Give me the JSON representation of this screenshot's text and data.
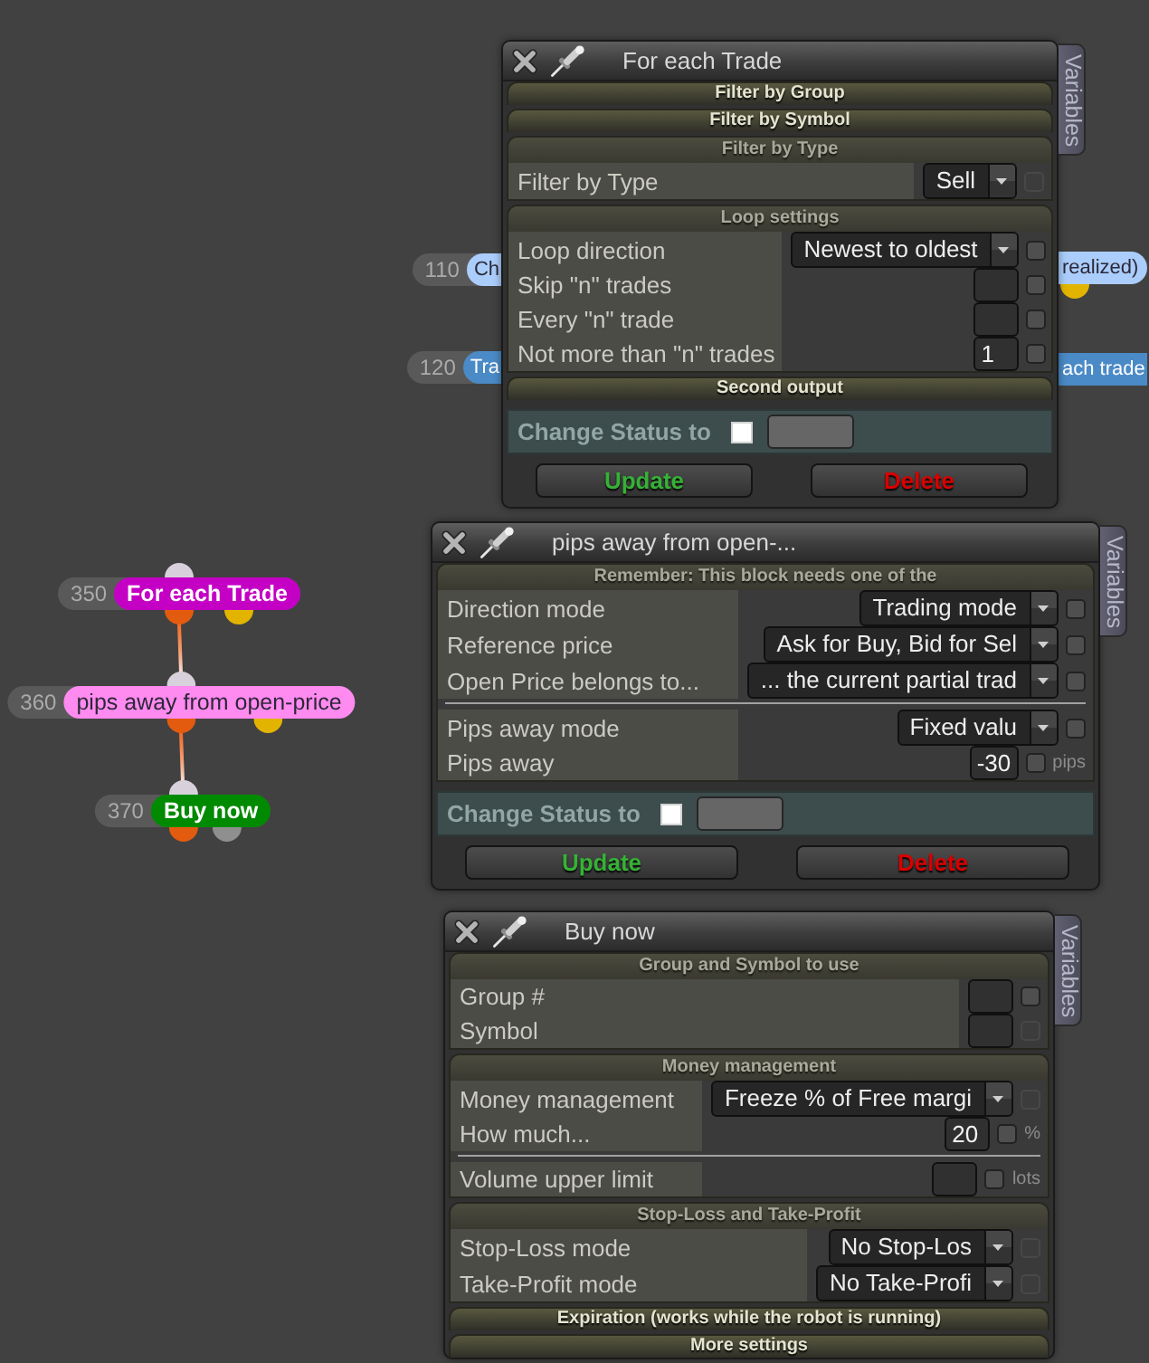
{
  "nodes": [
    {
      "kind": "cut-right",
      "number": "110",
      "label": "Ch",
      "color": "#aacdfb"
    },
    {
      "kind": "cut-left",
      "label": "realized)",
      "color": "#aacdfb",
      "outputs": [
        {
          "color": "#e2b400"
        }
      ]
    },
    {
      "kind": "cut-right",
      "number": "120",
      "label": "Tra",
      "color": "#4a8ac6"
    },
    {
      "kind": "cut-both",
      "label": "ach trade",
      "color": "#4a8ac6"
    },
    {
      "kind": "whole",
      "number": "350",
      "label": "For each Trade",
      "color": "#c400c4",
      "outputs": [
        {
          "color": "#e35b0e"
        },
        {
          "color": "#e2b400"
        }
      ]
    },
    {
      "kind": "whole",
      "number": "360",
      "label": "pips away from open-price",
      "color": "#ff8af0",
      "outputs": [
        {
          "color": "#e35b0e"
        },
        {
          "color": "#e2b400"
        }
      ]
    },
    {
      "kind": "whole",
      "number": "370",
      "label": "Buy now",
      "color": "#008a00",
      "outputs": [
        {
          "color": "#e35b0e"
        },
        {
          "color": "#8f8f8f"
        }
      ]
    }
  ],
  "panels": [
    {
      "title": "For each Trade",
      "tab": "Variables",
      "sections": [
        {
          "title": "Filter by Group",
          "expanded": false
        },
        {
          "title": "Filter by Symbol",
          "expanded": false
        },
        {
          "title": "Filter by Type",
          "expanded": true,
          "groups": [
            {
              "rows": [
                {
                  "label": "Filter by Type",
                  "control": {
                    "kind": "dropdown",
                    "value": "Sell"
                  },
                  "checkbox": {
                    "checked": false,
                    "disabled": true
                  }
                }
              ]
            }
          ]
        },
        {
          "title": "Loop settings",
          "expanded": true,
          "groups": [
            {
              "rows": [
                {
                  "label": "Loop direction",
                  "control": {
                    "kind": "dropdown",
                    "value": "Newest to oldest"
                  },
                  "checkbox": {
                    "checked": false,
                    "disabled": false
                  }
                },
                {
                  "label": "Skip \"n\" trades",
                  "control": {
                    "kind": "input"
                  },
                  "checkbox": {
                    "checked": false,
                    "disabled": false
                  }
                },
                {
                  "label": "Every \"n\" trade",
                  "control": {
                    "kind": "input"
                  },
                  "checkbox": {
                    "checked": false,
                    "disabled": false
                  }
                },
                {
                  "label": "Not more than \"n\" trades",
                  "control": {
                    "kind": "input",
                    "value": "1"
                  },
                  "checkbox": {
                    "checked": false,
                    "disabled": false
                  }
                }
              ]
            }
          ]
        },
        {
          "title": "Second output",
          "expanded": false
        }
      ],
      "status": {
        "label": "Change Status to",
        "checked": false
      },
      "buttons": [
        {
          "label": "Update",
          "kind": "primary"
        },
        {
          "label": "Delete",
          "kind": "danger"
        }
      ]
    },
    {
      "title": "pips away from open-...",
      "tab": "Variables",
      "sections": [
        {
          "title": "Remember: This block needs one of the",
          "expanded": true,
          "groups": [
            {
              "rows": [
                {
                  "label": "Direction mode",
                  "control": {
                    "kind": "dropdown",
                    "value": "Trading mode"
                  },
                  "checkbox": {
                    "checked": false,
                    "disabled": false
                  }
                },
                {
                  "label": "Reference price",
                  "control": {
                    "kind": "dropdown",
                    "value": "Ask for Buy, Bid for Sel"
                  },
                  "checkbox": {
                    "checked": false,
                    "disabled": false
                  }
                },
                {
                  "label": "Open Price belongs to...",
                  "control": {
                    "kind": "dropdown",
                    "value": "... the current partial trad"
                  },
                  "checkbox": {
                    "checked": false,
                    "disabled": false
                  }
                }
              ]
            },
            {
              "rows": [
                {
                  "label": "Pips away mode",
                  "control": {
                    "kind": "dropdown",
                    "value": "Fixed valu"
                  },
                  "checkbox": {
                    "checked": false,
                    "disabled": false
                  }
                },
                {
                  "label": "Pips away",
                  "control": {
                    "kind": "input",
                    "value": "-30"
                  },
                  "checkbox": {
                    "checked": false,
                    "disabled": false
                  },
                  "unit": "pips"
                }
              ]
            }
          ]
        }
      ],
      "status": {
        "label": "Change Status to",
        "checked": false
      },
      "buttons": [
        {
          "label": "Update",
          "kind": "primary"
        },
        {
          "label": "Delete",
          "kind": "danger"
        }
      ]
    },
    {
      "title": "Buy now",
      "tab": "Variables",
      "sections": [
        {
          "title": "Group and Symbol to use",
          "expanded": true,
          "groups": [
            {
              "rows": [
                {
                  "label": "Group #",
                  "control": {
                    "kind": "input"
                  },
                  "checkbox": {
                    "checked": false,
                    "disabled": false
                  }
                },
                {
                  "label": "Symbol",
                  "control": {
                    "kind": "input"
                  },
                  "checkbox": {
                    "checked": false,
                    "disabled": true
                  }
                }
              ]
            }
          ]
        },
        {
          "title": "Money management",
          "expanded": true,
          "groups": [
            {
              "rows": [
                {
                  "label": "Money management",
                  "control": {
                    "kind": "dropdown",
                    "value": "Freeze % of Free margi"
                  },
                  "checkbox": {
                    "checked": false,
                    "disabled": true
                  }
                },
                {
                  "label": "How much...",
                  "control": {
                    "kind": "input",
                    "value": "20"
                  },
                  "checkbox": {
                    "checked": false,
                    "disabled": false
                  },
                  "unit": "%"
                }
              ]
            },
            {
              "rows": [
                {
                  "label": "Volume upper limit",
                  "control": {
                    "kind": "input"
                  },
                  "checkbox": {
                    "checked": false,
                    "disabled": false
                  },
                  "unit": "lots"
                }
              ]
            }
          ]
        },
        {
          "title": "Stop-Loss and Take-Profit",
          "expanded": true,
          "groups": [
            {
              "rows": [
                {
                  "label": "Stop-Loss mode",
                  "control": {
                    "kind": "dropdown",
                    "value": "No Stop-Los"
                  },
                  "checkbox": {
                    "checked": false,
                    "disabled": true
                  }
                },
                {
                  "label": "Take-Profit mode",
                  "control": {
                    "kind": "dropdown",
                    "value": "No Take-Profi"
                  },
                  "checkbox": {
                    "checked": false,
                    "disabled": true
                  }
                }
              ]
            }
          ]
        },
        {
          "title": "Expiration (works while the robot is running)",
          "expanded": false
        },
        {
          "title": "More settings",
          "expanded": false
        }
      ]
    }
  ]
}
